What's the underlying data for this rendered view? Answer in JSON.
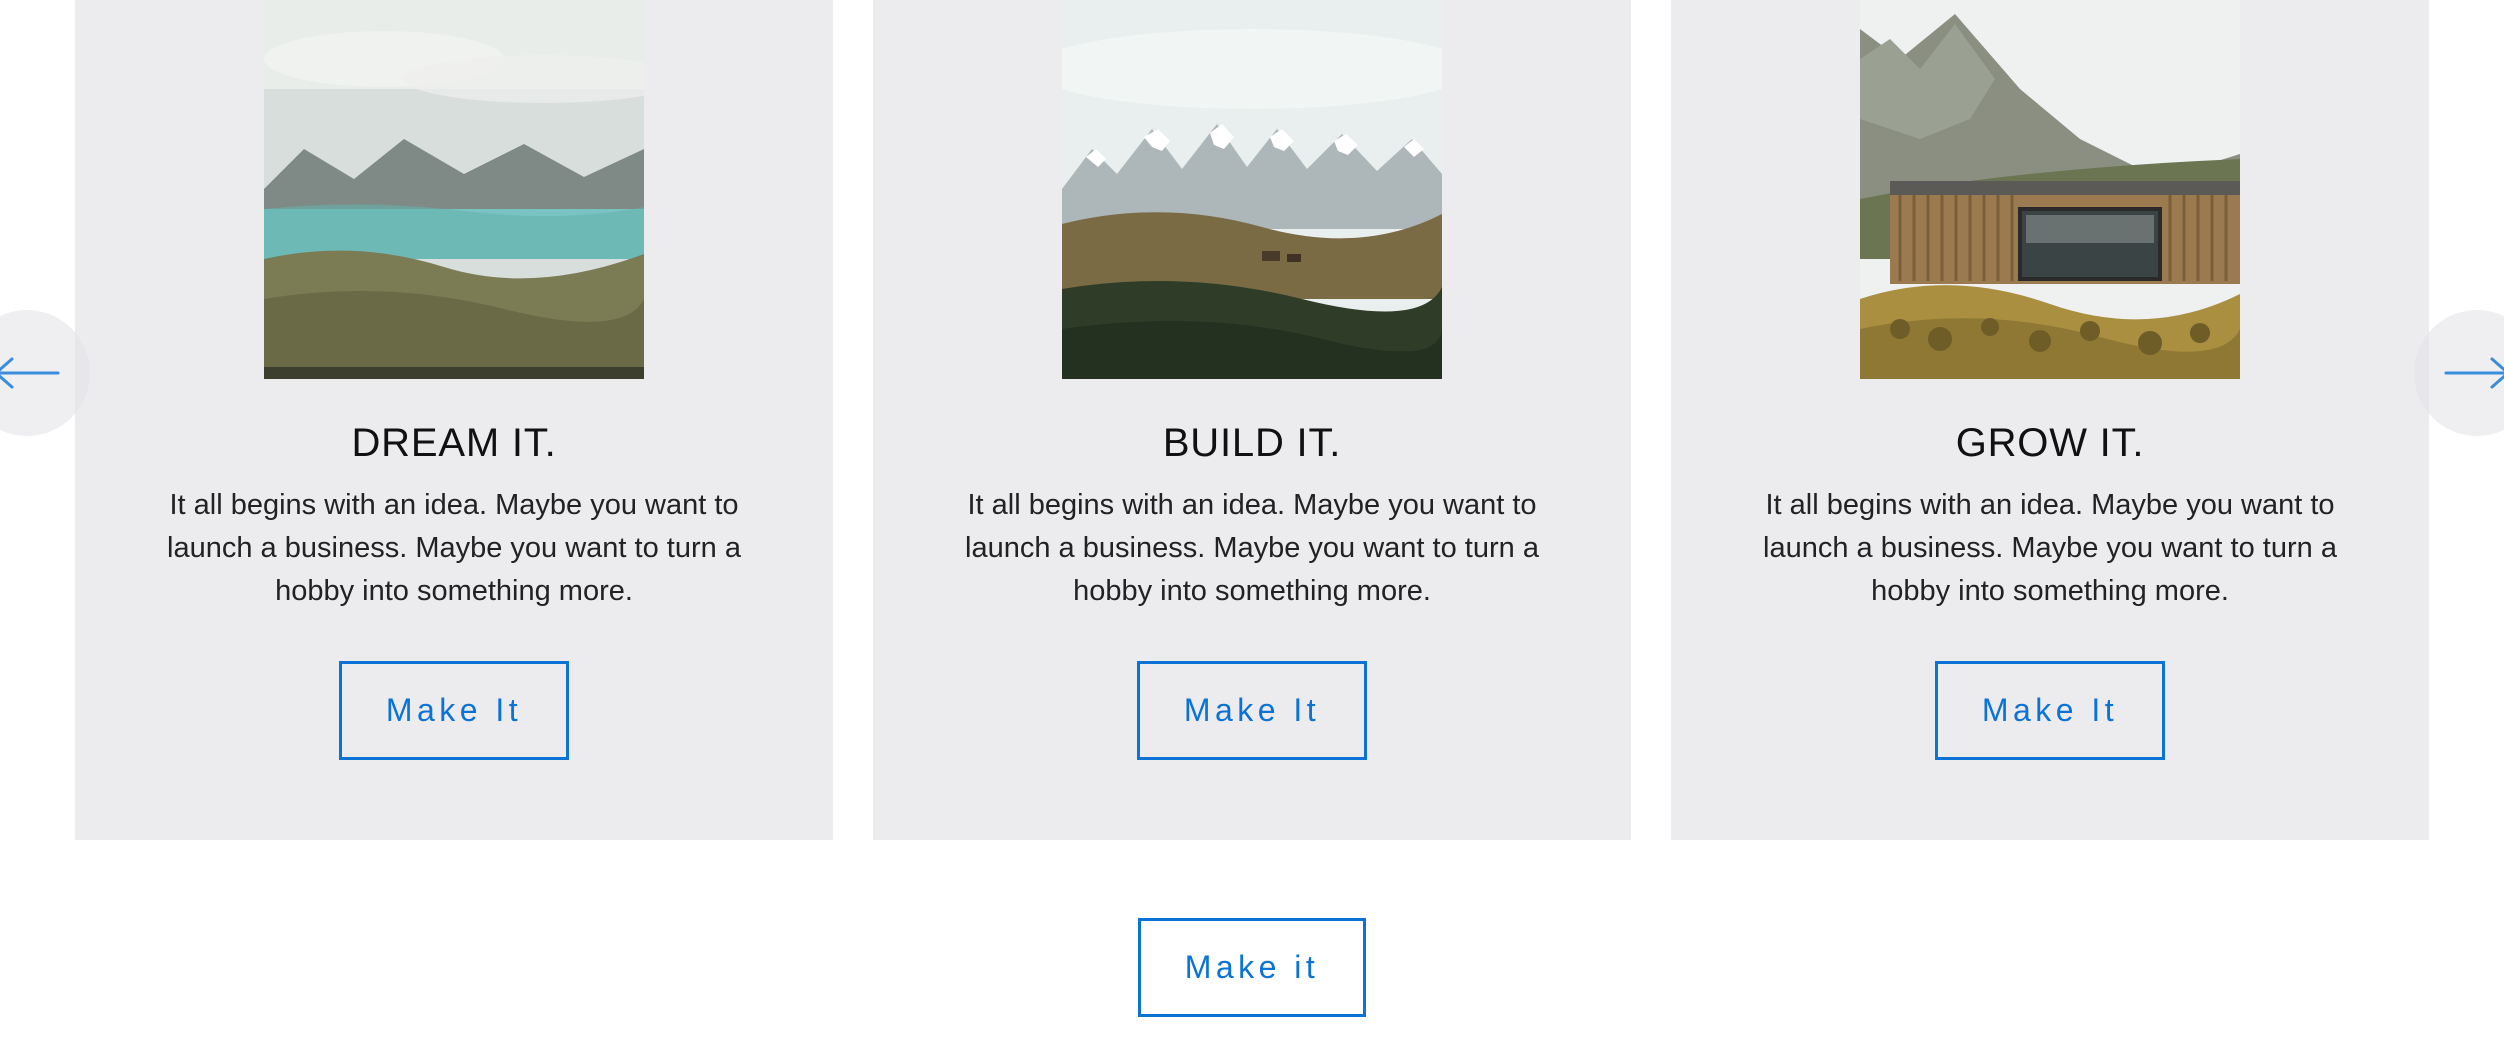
{
  "cards": [
    {
      "title": "DREAM IT.",
      "desc": "It all begins with an idea. Maybe you want to launch a business. Maybe you want to turn a hobby into something more.",
      "button_label": "Make It"
    },
    {
      "title": "BUILD IT.",
      "desc": "It all begins with an idea. Maybe you want to launch a business. Maybe you want to turn a hobby into something more.",
      "button_label": "Make It"
    },
    {
      "title": "GROW IT.",
      "desc": "It all begins with an idea. Maybe you want to launch a business. Maybe you want to turn a hobby into something more.",
      "button_label": "Make It"
    }
  ],
  "global_button_label": "Make it",
  "nav": {
    "prev_name": "arrow-left-icon",
    "next_name": "arrow-right-icon"
  }
}
